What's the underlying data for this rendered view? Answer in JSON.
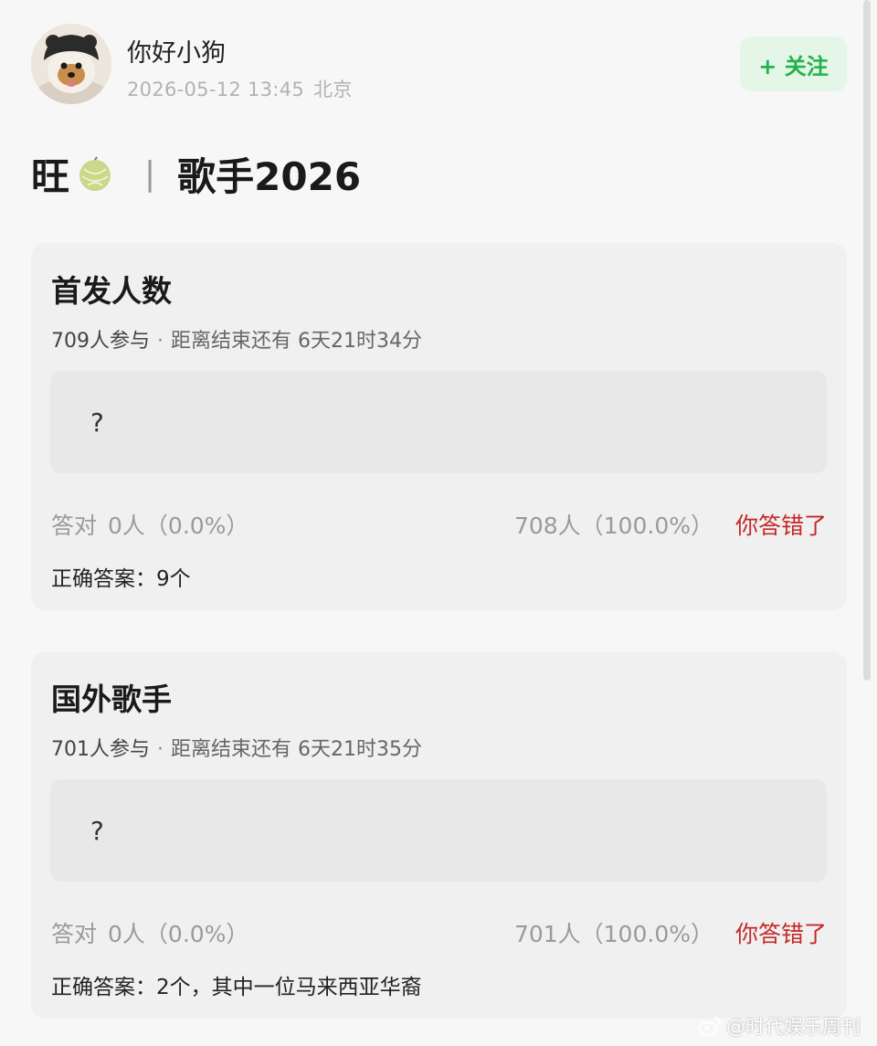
{
  "post": {
    "author": "你好小狗",
    "timestamp": "2026-05-12 13:45",
    "location": "北京",
    "follow_label": "+ 关注",
    "title_prefix": "旺",
    "title_separator": "|",
    "title_main": "歌手2026"
  },
  "polls": [
    {
      "question": "首发人数",
      "participants": "709人参与",
      "dot": "·",
      "time_left": "距离结束还有 6天21时34分",
      "option": "?",
      "correct_label": "答对",
      "correct_count": "0人（0.0%）",
      "other_count": "708人（100.0%）",
      "wrong_label": "你答错了",
      "answer": "正确答案：9个"
    },
    {
      "question": "国外歌手",
      "participants": "701人参与",
      "dot": "·",
      "time_left": "距离结束还有 6天21时35分",
      "option": "?",
      "correct_label": "答对",
      "correct_count": "0人（0.0%）",
      "other_count": "701人（100.0%）",
      "wrong_label": "你答错了",
      "answer": "正确答案：2个，其中一位马来西亚华裔"
    }
  ],
  "watermark": "@时代娱乐周刊",
  "icons": {
    "avatar": "dog-avatar",
    "title_emoji": "melon-icon",
    "watermark": "weibo-icon"
  },
  "colors": {
    "follow_green": "#23b24b",
    "wrong_red": "#c62828"
  }
}
